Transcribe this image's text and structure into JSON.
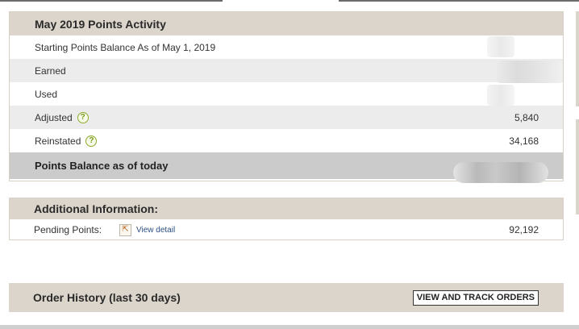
{
  "activity": {
    "title": "May 2019 Points Activity",
    "rows": [
      {
        "label": "Starting Points Balance As of May 1, 2019",
        "value": "",
        "help": false
      },
      {
        "label": "Earned",
        "value": "",
        "help": false
      },
      {
        "label": "Used",
        "value": "",
        "help": false
      },
      {
        "label": "Adjusted",
        "value": "5,840",
        "help": true
      },
      {
        "label": "Reinstated",
        "value": "34,168",
        "help": true
      }
    ],
    "balance_label": "Points Balance as of today",
    "balance_value": ""
  },
  "additional": {
    "title": "Additional Information:",
    "pending_label": "Pending Points:",
    "detail_link": "View detail",
    "pending_value": "92,192"
  },
  "orders": {
    "title": "Order History (last 30 days)",
    "button": "VIEW AND TRACK ORDERS"
  },
  "icons": {
    "help": "question-mark-circle-icon",
    "external": "external-link-icon"
  },
  "colors": {
    "header_bg": "#dcd5cb",
    "row_shade": "#ececec",
    "balance_bg": "#cbcbcb",
    "help_accent": "#8cab2c",
    "link": "#2a4f7f"
  }
}
